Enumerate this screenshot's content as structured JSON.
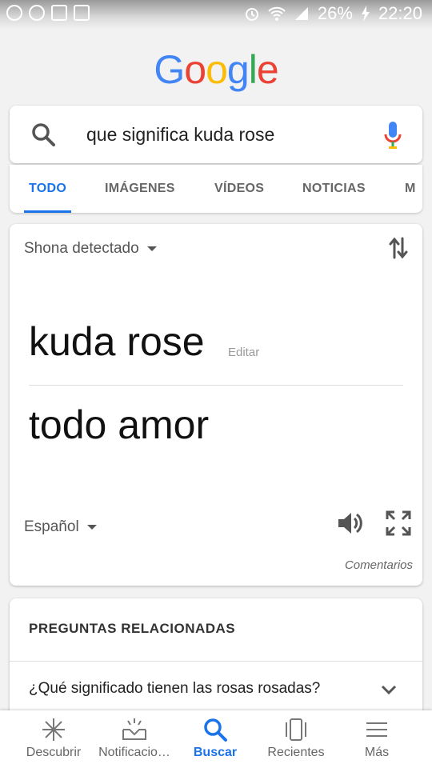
{
  "status_bar": {
    "battery": "26%",
    "time": "22:20"
  },
  "logo": {
    "letters": [
      "G",
      "o",
      "o",
      "g",
      "l",
      "e"
    ]
  },
  "colors": {
    "blue": "#4285f4",
    "red": "#ea4335",
    "yellow": "#fbbc05",
    "green": "#34a853",
    "accent": "#1a73e8"
  },
  "search": {
    "query": "que significa kuda rose"
  },
  "tabs": [
    {
      "label": "TODO",
      "active": true
    },
    {
      "label": "IMÁGENES"
    },
    {
      "label": "VÍDEOS"
    },
    {
      "label": "NOTICIAS"
    },
    {
      "label": "M"
    }
  ],
  "translate": {
    "source_lang": "Shona detectado",
    "source_text": "kuda rose",
    "edit_label": "Editar",
    "target_text": "todo amor",
    "target_lang": "Español",
    "feedback": "Comentarios"
  },
  "related": {
    "heading": "PREGUNTAS RELACIONADAS",
    "questions": [
      "¿Qué significado tienen las rosas rosadas?"
    ]
  },
  "bottom_nav": [
    {
      "label": "Descubrir",
      "icon": "asterisk-icon"
    },
    {
      "label": "Notificacio…",
      "icon": "inbox-icon"
    },
    {
      "label": "Buscar",
      "icon": "search-icon",
      "active": true
    },
    {
      "label": "Recientes",
      "icon": "recents-icon"
    },
    {
      "label": "Más",
      "icon": "menu-icon"
    }
  ]
}
